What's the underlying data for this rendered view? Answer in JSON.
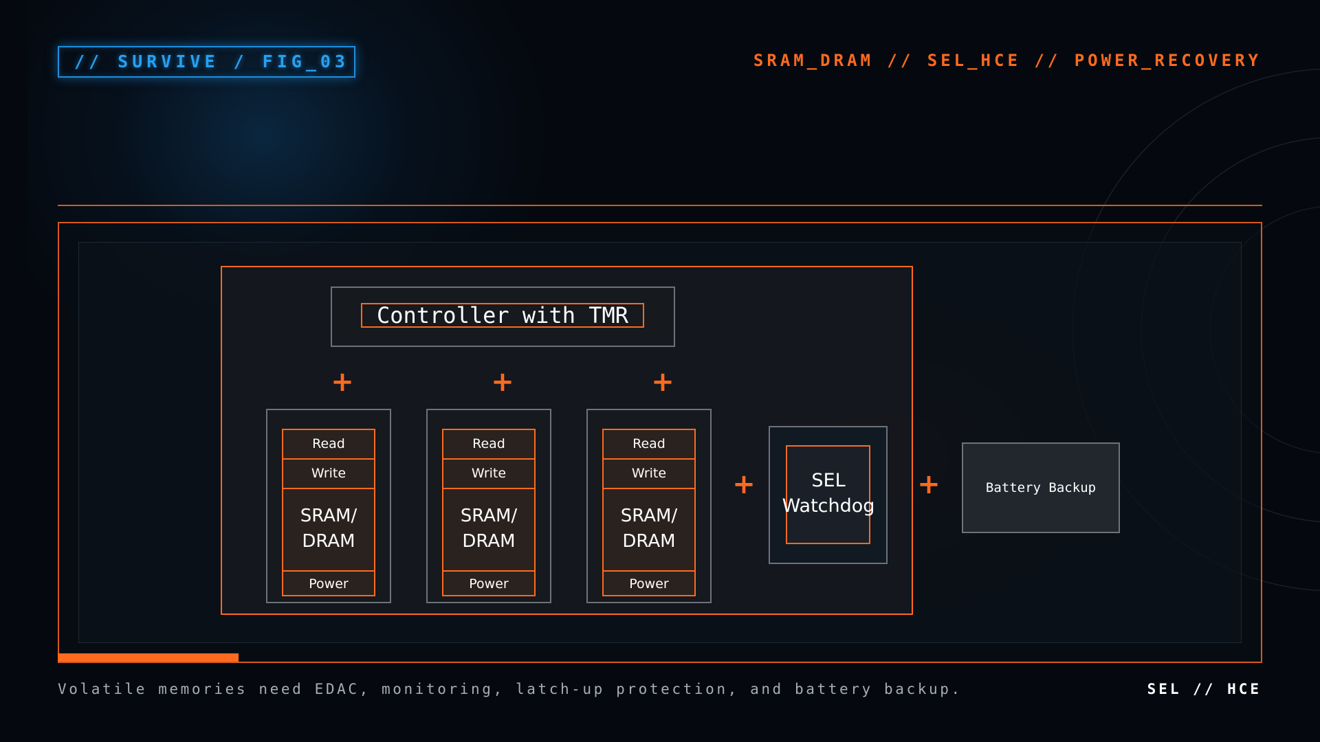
{
  "header": {
    "tag": "// SURVIVE / FIG_03",
    "topics": "SRAM_DRAM // SEL_HCE // POWER_RECOVERY"
  },
  "diagram": {
    "controller": "Controller with TMR",
    "plus": "+",
    "memory_units": [
      {
        "read": "Read",
        "write": "Write",
        "memory": "SRAM/\nDRAM",
        "power": "Power"
      },
      {
        "read": "Read",
        "write": "Write",
        "memory": "SRAM/\nDRAM",
        "power": "Power"
      },
      {
        "read": "Read",
        "write": "Write",
        "memory": "SRAM/\nDRAM",
        "power": "Power"
      }
    ],
    "sel_watchdog": "SEL\nWatchdog",
    "battery_backup": "Battery Backup"
  },
  "footer": {
    "caption": "Volatile memories need EDAC, monitoring, latch-up protection, and battery backup.",
    "tag": "SEL // HCE"
  },
  "colors": {
    "accent": "#ff6a1f",
    "blue": "#27a0f2",
    "background": "#05090f"
  }
}
